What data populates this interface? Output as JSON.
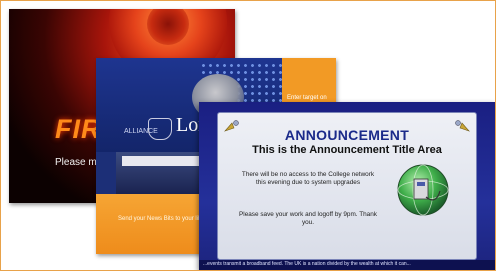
{
  "fire_screen": {
    "title": "FIR",
    "text": "Please mo"
  },
  "lords_screen": {
    "logo_text": "Lor",
    "orange_panel_text": "Enter target on broadband here",
    "small_text": "ALLIANCE",
    "bottom_text": "Send your News Bits to your library"
  },
  "announcement_screen": {
    "title": "ANNOUNCEMENT",
    "subtitle": "This is the Announcement Title Area",
    "body_1": "There will be no access to the College network this evening due to system upgrades",
    "body_2": "Please save your work and logoff by 9pm. Thank you.",
    "ticker": "...events transmit a broadband feed. The UK is a nation divided by the wealth at which it can..."
  },
  "colors": {
    "frame_border": "#e8a24a",
    "fire_title": "#ff8a1a",
    "lords_blue": "#1c2f77",
    "lords_orange": "#f29a25",
    "announcement_title": "#1a2a8a"
  }
}
